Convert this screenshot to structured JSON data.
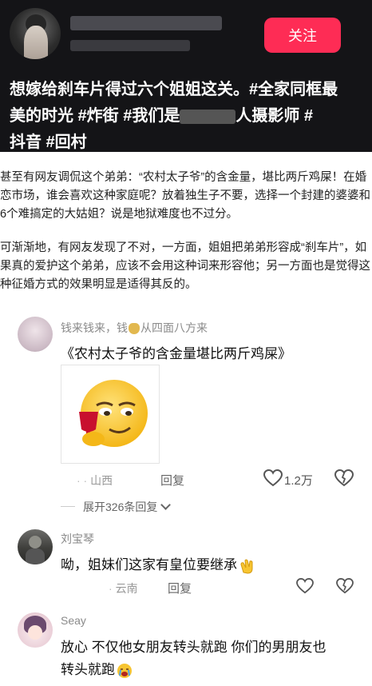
{
  "video": {
    "follow_label": "关注",
    "caption_line1": "想嫁给刹车片得过六个姐姐这关。#全家同框最",
    "caption_line2a": "美的时光 #炸街 #我们是",
    "caption_line2b": "人摄影师 #",
    "caption_line3": "抖音 #回村"
  },
  "article": {
    "para1": [
      "甚至有网友调侃这个弟弟：“农村太子爷”的含金量，堪比两斤鸡屎！在婚",
      "恋市场，谁会喜欢这种家庭呢？放着独生子不要，选择一个封建的婆婆和",
      "6个难搞定的大姑姐？说是地狱难度也不过分。"
    ],
    "para2": [
      "可渐渐地，有网友发现了不对，一方面，姐姐把弟弟形容成“刹车片”，如",
      "果真的爱护这个弟弟，应该不会用这种词来形容他；另一方面也是觉得这",
      "种征婚方式的效果明显是适得其反的。"
    ]
  },
  "comments": [
    {
      "name_a": "钱来钱来，钱",
      "name_b": "从四面八方来",
      "text": "《农村太子爷的含金量堪比两斤鸡屎》",
      "location": "山西",
      "reply": "回复",
      "likes": "1.2万",
      "expand": "展开326条回复"
    },
    {
      "name": "刘宝琴",
      "text": "呦，姐妹们这家有皇位要继承",
      "location": "云南",
      "reply": "回复"
    },
    {
      "name": "Seay",
      "text_line1": "放心 不仅他女朋友转头就跑 你们的男朋友也",
      "text_line2": "转头就跑"
    }
  ],
  "colors": {
    "accent": "#fe2c55",
    "header_bg": "#141417"
  }
}
